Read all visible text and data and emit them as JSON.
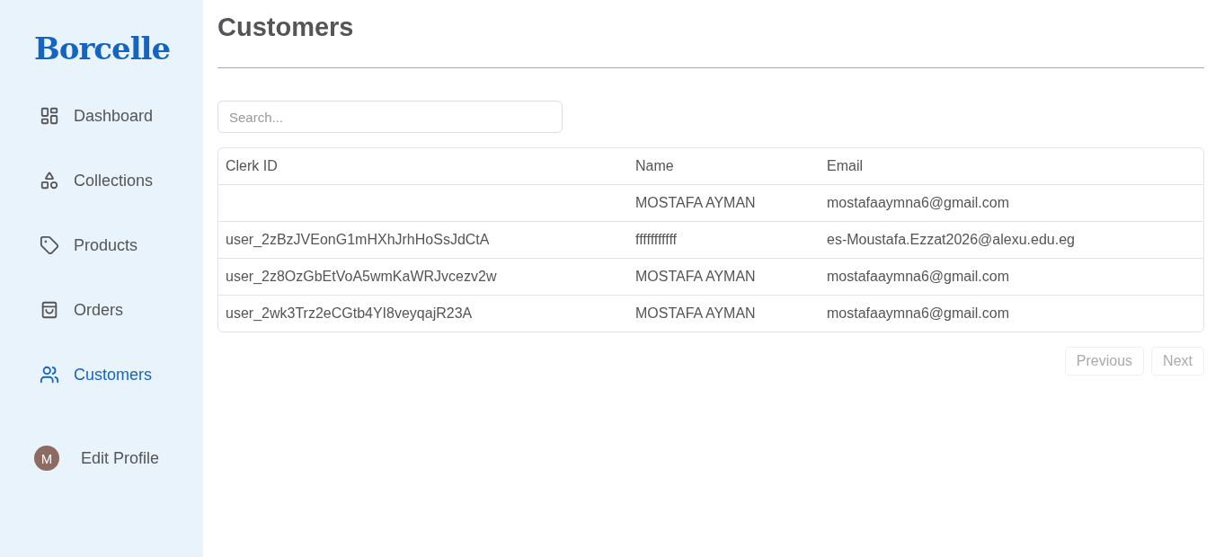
{
  "sidebar": {
    "logo": "Borcelle",
    "items": [
      {
        "label": "Dashboard",
        "selected": false
      },
      {
        "label": "Collections",
        "selected": false
      },
      {
        "label": "Products",
        "selected": false
      },
      {
        "label": "Orders",
        "selected": false
      },
      {
        "label": "Customers",
        "selected": true
      }
    ],
    "profile": {
      "initial": "M",
      "label": "Edit Profile"
    }
  },
  "page": {
    "title": "Customers"
  },
  "search": {
    "placeholder": "Search..."
  },
  "table": {
    "columns": [
      "Clerk ID",
      "Name",
      "Email"
    ],
    "rows": [
      [
        "",
        "MOSTAFA AYMAN",
        "mostafaaymna6@gmail.com"
      ],
      [
        "user_2zBzJVEonG1mHXhJrhHoSsJdCtA",
        "fffffffffff",
        "es-Moustafa.Ezzat2026@alexu.edu.eg"
      ],
      [
        "user_2z8OzGbEtVoA5wmKaWRJvcezv2w",
        "MOSTAFA AYMAN",
        "mostafaaymna6@gmail.com"
      ],
      [
        "user_2wk3Trz2eCGtb4YI8veyqajR23A",
        "MOSTAFA AYMAN",
        "mostafaaymna6@gmail.com"
      ]
    ]
  },
  "pagination": [
    {
      "label": "Previous",
      "disabled": true
    },
    {
      "label": "Next",
      "disabled": true
    }
  ]
}
